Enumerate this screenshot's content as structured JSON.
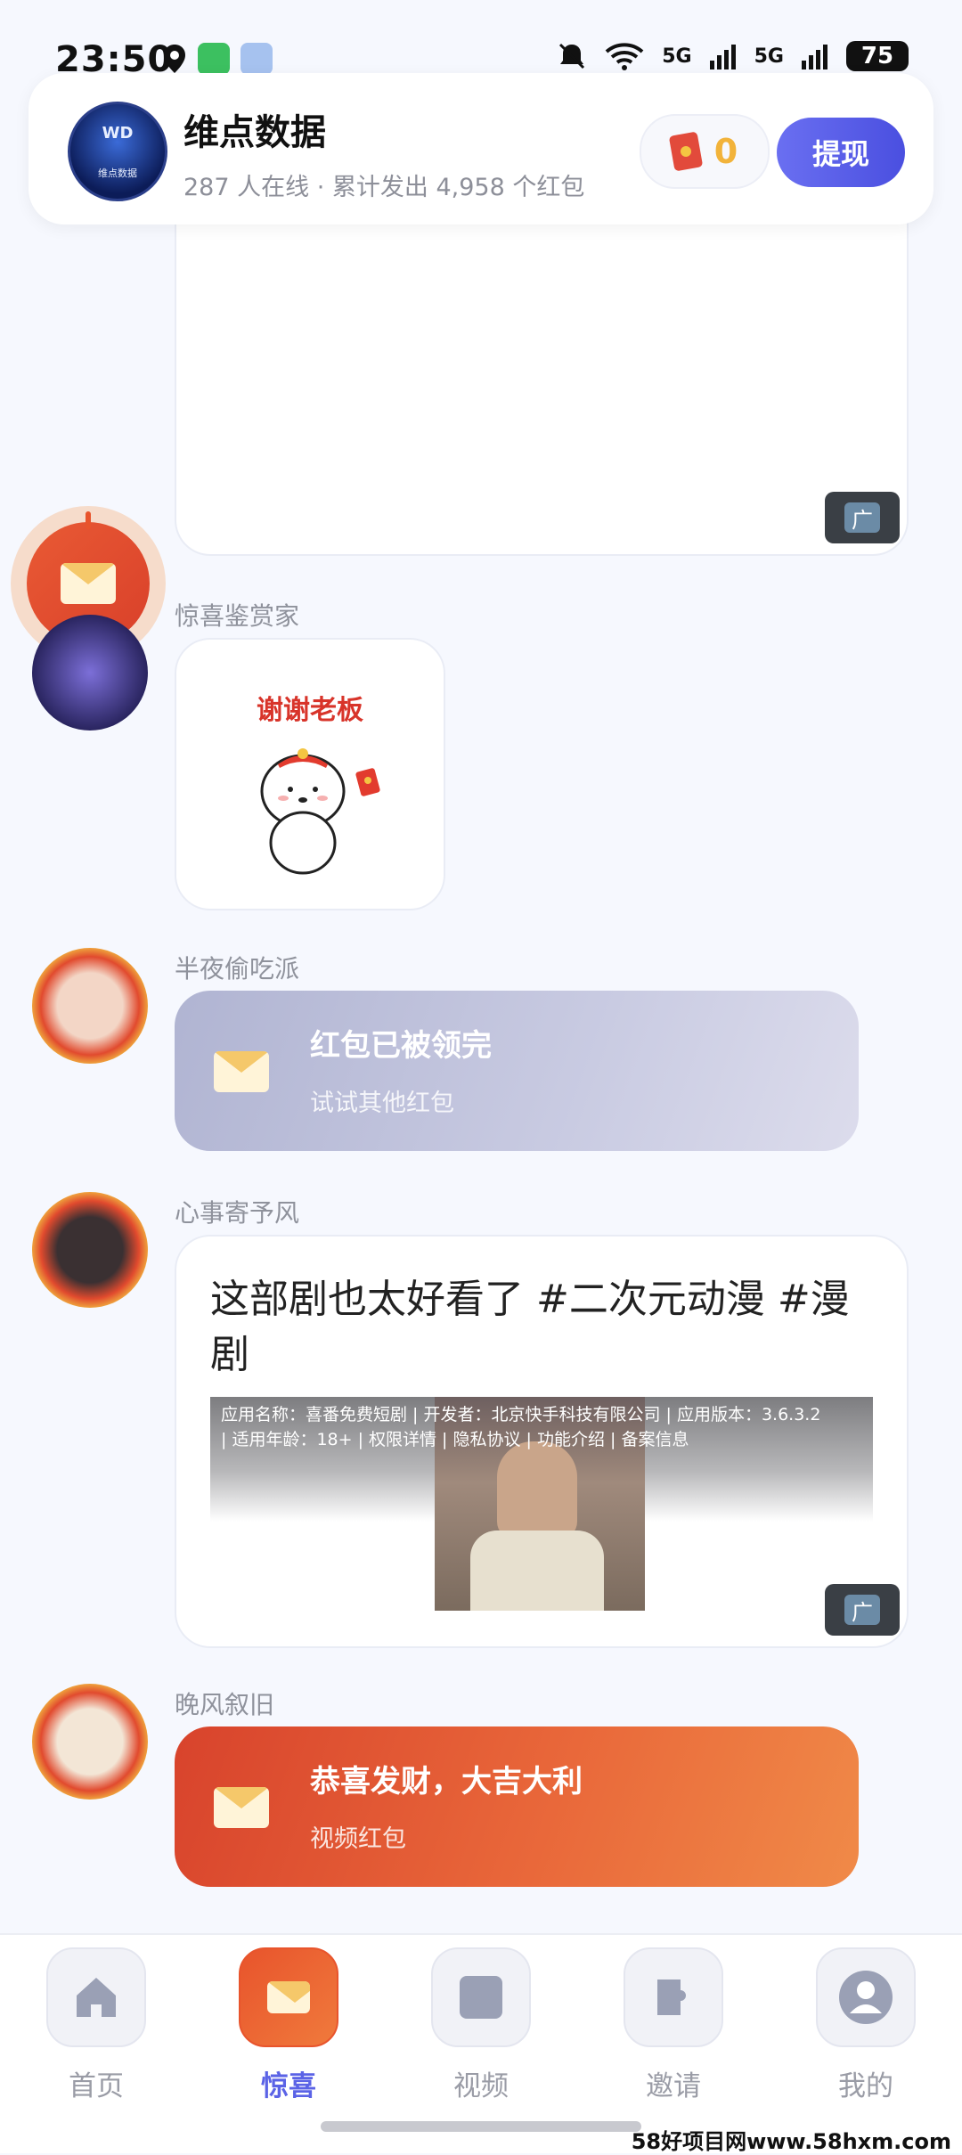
{
  "status_bar": {
    "time": "23:50",
    "signal1": "5G",
    "signal2": "5G",
    "battery": "75"
  },
  "header": {
    "logo_text": "WD",
    "logo_caption": "维点数据",
    "title": "维点数据",
    "subtitle": "287 人在线 · 累计发出 4,958 个红包",
    "coin_count": "0",
    "withdraw_label": "提现"
  },
  "feed": {
    "ad_badge": "广",
    "message1": {
      "user": "惊喜鉴赏家",
      "sticker_text": "谢谢老板"
    },
    "message2": {
      "user": "半夜偷吃派",
      "title": "红包已被领完",
      "subtitle": "试试其他红包"
    },
    "message3": {
      "user": "心事寄予风",
      "text": "这部剧也太好看了 #二次元动漫 #漫剧",
      "ad_info_line1": "应用名称：喜番免费短剧 | 开发者：北京快手科技有限公司 | 应用版本：3.6.3.2",
      "ad_info_line2": "| 适用年龄：18+ | 权限详情 | 隐私协议 | 功能介绍 | 备案信息"
    },
    "message4": {
      "user": "晚风叙旧",
      "title": "恭喜发财，大吉大利",
      "subtitle": "视频红包"
    }
  },
  "nav": {
    "items": [
      {
        "label": "首页",
        "icon": "home-icon"
      },
      {
        "label": "惊喜",
        "icon": "envelope-icon"
      },
      {
        "label": "视频",
        "icon": "video-icon"
      },
      {
        "label": "邀请",
        "icon": "invite-icon"
      },
      {
        "label": "我的",
        "icon": "profile-icon"
      }
    ],
    "active": "惊喜"
  },
  "watermark": "58好项目网www.58hxm.com",
  "colors": {
    "accent": "#5b63e6",
    "red_packet": "#e8542c",
    "claimed": "#b4b8d4"
  }
}
